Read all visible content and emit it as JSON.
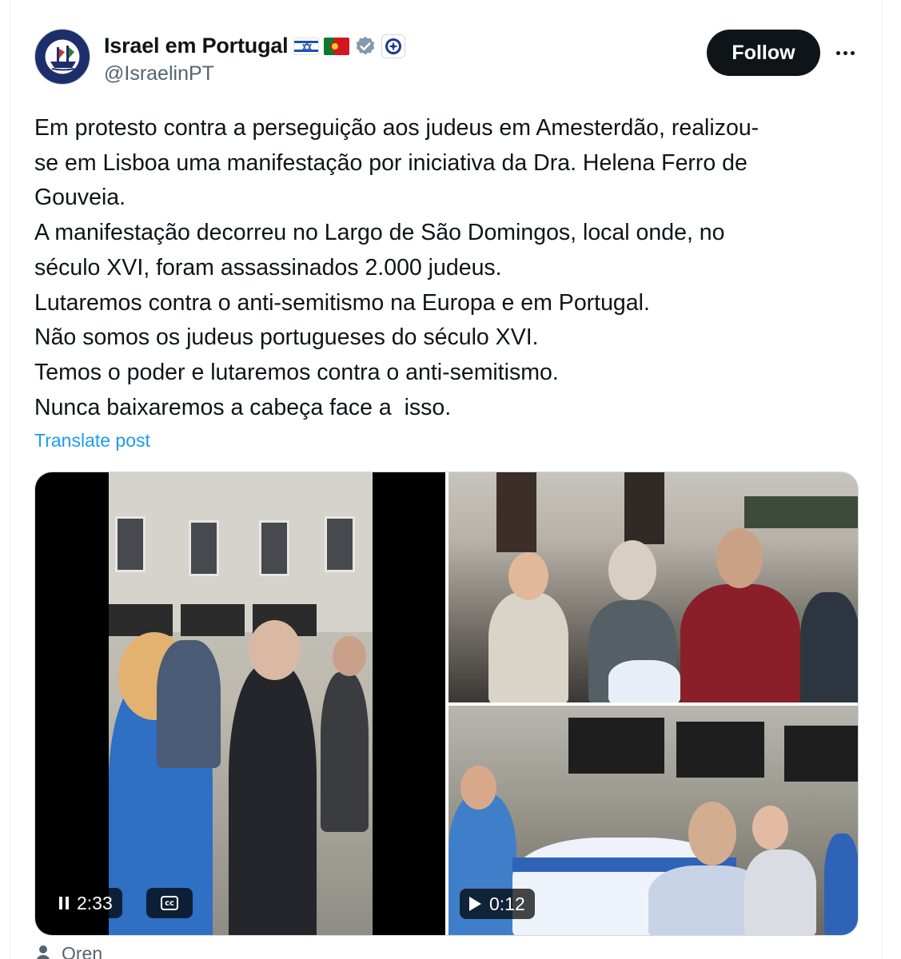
{
  "author": {
    "display_name": "Israel em Portugal",
    "handle": "@IsraelinPT",
    "badges": [
      "israel-flag",
      "portugal-flag",
      "verified-gray-badge",
      "affiliate-badge"
    ]
  },
  "actions": {
    "follow_label": "Follow",
    "more_icon": "more-horizontal-icon"
  },
  "post": {
    "lines": [
      "Em protesto contra a perseguição aos judeus em Amesterdão, realizou-",
      "se em Lisboa uma manifestação por iniciativa da Dra. Helena Ferro de",
      "Gouveia.",
      "A manifestação decorreu no Largo de São Domingos, local onde, no",
      "século XVI, foram assassinados 2.000 judeus.",
      "Lutaremos contra o anti-semitismo na Europa e em Portugal.",
      "Não somos os judeus portugueses do século XVI.",
      "Temos o poder e lutaremos contra o anti-semitismo.",
      "Nunca baixaremos a cabeça face a  isso."
    ],
    "translate_label": "Translate post"
  },
  "media": {
    "video_main": {
      "time": "2:33",
      "state_icon": "pause-icon",
      "captions_icon": "closed-captions-icon"
    },
    "photo_top_right": {
      "description_icon": "crowd-photo"
    },
    "video_bottom_right": {
      "time": "0:12",
      "state_icon": "play-icon"
    }
  },
  "footer": {
    "name": "Oren",
    "icon": "person-icon"
  },
  "colors": {
    "text": "#0f1419",
    "secondary": "#536471",
    "link": "#1d9bf0",
    "follow_bg": "#0f1419"
  }
}
